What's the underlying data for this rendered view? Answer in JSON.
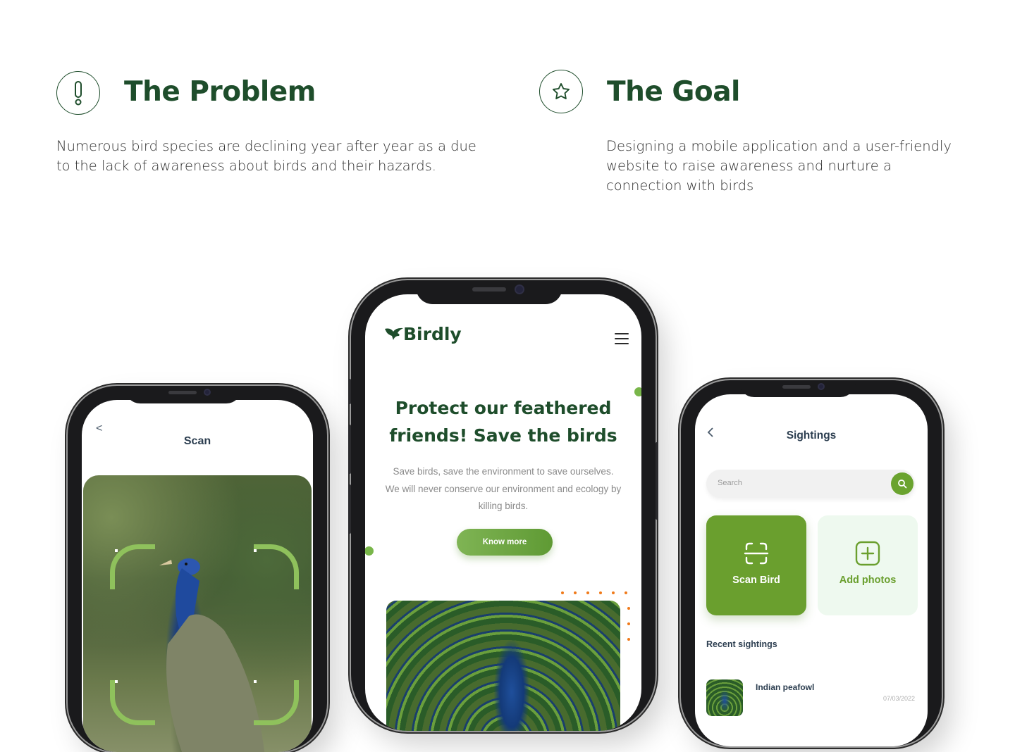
{
  "problem": {
    "title": "The Problem",
    "text": "Numerous bird species are declining year after year as a due to the lack of awareness about birds and their hazards."
  },
  "goal": {
    "title": "The Goal",
    "text": "Designing a mobile application and a user-friendly website to raise awareness and nurture a connection with birds"
  },
  "scan_screen": {
    "back": "<",
    "title": "Scan"
  },
  "web_screen": {
    "logo": "Birdly",
    "hero_title": "Protect our feathered friends! Save the birds",
    "hero_text": "Save birds, save the environment to save ourselves. We will never conserve our environment and ecology by killing birds.",
    "cta": "Know more"
  },
  "sightings_screen": {
    "title": "Sightings",
    "search_placeholder": "Search",
    "scan_card": "Scan Bird",
    "add_card": "Add photos",
    "recent_title": "Recent sightings",
    "recent": [
      {
        "name": "Indian peafowl",
        "date": "07/03/2022"
      }
    ]
  },
  "colors": {
    "brand_green_dark": "#1e4d2b",
    "brand_green": "#6a9f2e",
    "accent_orange": "#f07a1a",
    "light_green_bg": "#eef9ef"
  },
  "icons": [
    "exclamation-icon",
    "star-icon",
    "bird-logo-icon",
    "hamburger-icon",
    "back-chevron-icon",
    "search-icon",
    "scan-icon",
    "add-photo-icon"
  ]
}
